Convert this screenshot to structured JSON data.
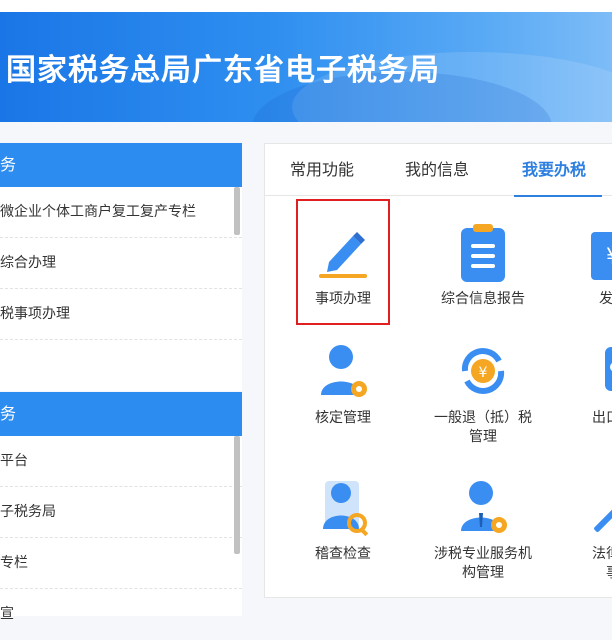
{
  "header": {
    "title": "国家税务总局广东省电子税务局"
  },
  "left_sections": [
    {
      "title": "务",
      "items": [
        "微企业个体工商户复工复产专栏",
        "综合办理",
        "税事项办理",
        ""
      ]
    },
    {
      "title": "务",
      "items": [
        "平台",
        "子税务局",
        "专栏",
        "宣"
      ]
    }
  ],
  "tabs": [
    {
      "label": "常用功能"
    },
    {
      "label": "我的信息"
    },
    {
      "label": "我要办税"
    }
  ],
  "tiles": [
    {
      "label": "事项办理",
      "icon": "pencil-icon"
    },
    {
      "label": "综合信息报告",
      "icon": "clipboard-icon"
    },
    {
      "label": "发票",
      "icon": "invoice-icon"
    },
    {
      "label": "核定管理",
      "icon": "user-gear-icon"
    },
    {
      "label1": "一般退（抵）税",
      "label2": "管理",
      "icon": "refund-cycle-icon"
    },
    {
      "label": "出口退",
      "icon": "export-icon"
    },
    {
      "label": "稽查检查",
      "icon": "inspect-icon"
    },
    {
      "label1": "涉税专业服务机",
      "label2": "构管理",
      "icon": "agent-gear-icon"
    },
    {
      "label1": "法律追",
      "label2": "事",
      "icon": "hammer-icon"
    }
  ],
  "colors": {
    "accent": "#2d8cf0",
    "icon_blue": "#3a8ef2",
    "icon_orange": "#f5a623",
    "highlight": "#e02020"
  }
}
